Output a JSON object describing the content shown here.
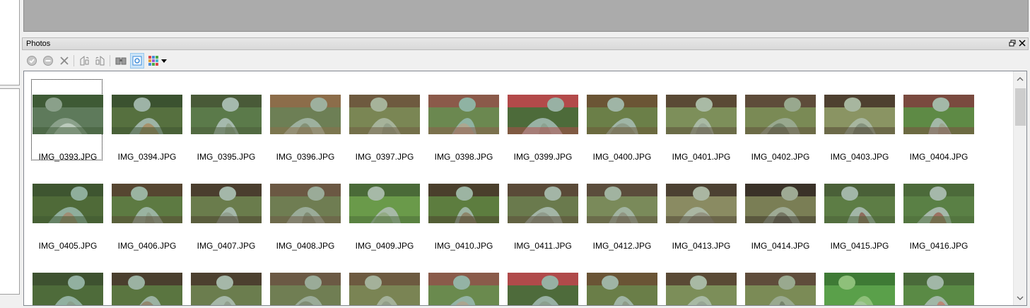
{
  "panel": {
    "title": "Photos"
  },
  "dock_buttons": [
    {
      "name": "restore-icon",
      "glyph": "🗗"
    },
    {
      "name": "close-icon",
      "glyph": "✕"
    }
  ],
  "toolbar": [
    {
      "name": "approve-icon"
    },
    {
      "name": "reject-icon"
    },
    {
      "name": "delete-icon"
    },
    {
      "name": "rotate-left-icon"
    },
    {
      "name": "rotate-right-icon"
    },
    {
      "name": "compare-icon"
    },
    {
      "name": "select-mode-icon"
    },
    {
      "name": "grid-view-icon"
    },
    {
      "name": "dropdown-arrow-icon"
    }
  ],
  "photos": [
    {
      "name": "IMG_0393.JPG",
      "selected": true,
      "colors": [
        "#5e7a5b",
        "#8aa08a",
        "#c7d4c8",
        "#3e5a35"
      ]
    },
    {
      "name": "IMG_0394.JPG",
      "colors": [
        "#56703f",
        "#9db3a6",
        "#a9885d",
        "#3b5230"
      ]
    },
    {
      "name": "IMG_0395.JPG",
      "colors": [
        "#5b7a4a",
        "#a5b9ad",
        "#8c9f84",
        "#495a38"
      ]
    },
    {
      "name": "IMG_0396.JPG",
      "colors": [
        "#6d7f55",
        "#9db09e",
        "#7e8a6c",
        "#8c6d4a"
      ]
    },
    {
      "name": "IMG_0397.JPG",
      "colors": [
        "#7a8654",
        "#a6b39a",
        "#8f9b84",
        "#6e5a3f"
      ]
    },
    {
      "name": "IMG_0398.JPG",
      "colors": [
        "#6b8850",
        "#8fb3a3",
        "#b3a48b",
        "#8b5a4a"
      ]
    },
    {
      "name": "IMG_0399.JPG",
      "colors": [
        "#4d6b3a",
        "#98b1a4",
        "#8a9d8b",
        "#b34a4a"
      ]
    },
    {
      "name": "IMG_0400.JPG",
      "colors": [
        "#6b7f48",
        "#9fb5a6",
        "#8a9783",
        "#6b5535"
      ]
    },
    {
      "name": "IMG_0401.JPG",
      "colors": [
        "#7d8f5a",
        "#a9baa5",
        "#95a292",
        "#5a4a35"
      ]
    },
    {
      "name": "IMG_0402.JPG",
      "colors": [
        "#7a8a55",
        "#98a88e",
        "#6d7a62",
        "#5e4c3a"
      ]
    },
    {
      "name": "IMG_0403.JPG",
      "colors": [
        "#8a9463",
        "#a7b69f",
        "#7c8a74",
        "#4e4030"
      ]
    },
    {
      "name": "IMG_0404.JPG",
      "colors": [
        "#5e8a45",
        "#a3b8a8",
        "#9aa38a",
        "#7a4a3f"
      ]
    },
    {
      "name": "IMG_0405.JPG",
      "colors": [
        "#4f6a38",
        "#8fae9c",
        "#a4866a",
        "#3e5530"
      ]
    },
    {
      "name": "IMG_0406.JPG",
      "colors": [
        "#5d7a42",
        "#9ab3a1",
        "#8b9c86",
        "#564631"
      ]
    },
    {
      "name": "IMG_0407.JPG",
      "colors": [
        "#6a7c4c",
        "#a4b7a9",
        "#8d9a88",
        "#4a3e2e"
      ]
    },
    {
      "name": "IMG_0408.JPG",
      "colors": [
        "#6f7d52",
        "#9aab98",
        "#7a856c",
        "#6b5843"
      ]
    },
    {
      "name": "IMG_0409.JPG",
      "colors": [
        "#6a9a4a",
        "#a6b9a7",
        "#8fa87d",
        "#4a6a38"
      ]
    },
    {
      "name": "IMG_0410.JPG",
      "colors": [
        "#5d7d3f",
        "#9cb4a2",
        "#8a7a5e",
        "#4a3f2c"
      ]
    },
    {
      "name": "IMG_0411.JPG",
      "colors": [
        "#6a7a4d",
        "#a3b5a6",
        "#8b9686",
        "#5a4a38"
      ]
    },
    {
      "name": "IMG_0412.JPG",
      "colors": [
        "#7a8a5a",
        "#a1b3a0",
        "#8d8f7c",
        "#5b4d3c"
      ]
    },
    {
      "name": "IMG_0413.JPG",
      "colors": [
        "#8a8b62",
        "#aab6a2",
        "#8e8c7a",
        "#4c4132"
      ]
    },
    {
      "name": "IMG_0414.JPG",
      "colors": [
        "#7a7e55",
        "#9eaa94",
        "#6a6a58",
        "#3a3228"
      ]
    },
    {
      "name": "IMG_0415.JPG",
      "colors": [
        "#5d7d45",
        "#a2b6a8",
        "#8a5a4a",
        "#4a6038"
      ]
    },
    {
      "name": "IMG_0416.JPG",
      "colors": [
        "#5a8045",
        "#a5b8aa",
        "#9a6050",
        "#4c6a3a"
      ]
    },
    {
      "name": "",
      "colors": [
        "#4e6b3a",
        "#92b0a0",
        "#8a9c88",
        "#3e5230"
      ]
    },
    {
      "name": "",
      "colors": [
        "#5a7540",
        "#9bb2a2",
        "#8e7d62",
        "#4a3f2e"
      ]
    },
    {
      "name": "",
      "colors": [
        "#6b7d4e",
        "#a5b7a8",
        "#8d9a88",
        "#4c402f"
      ]
    },
    {
      "name": "",
      "colors": [
        "#707e53",
        "#9aab98",
        "#7b866d",
        "#6b5944"
      ]
    },
    {
      "name": "",
      "colors": [
        "#7a8454",
        "#a4b19a",
        "#8d9a84",
        "#6d5a40"
      ]
    },
    {
      "name": "",
      "colors": [
        "#6a8a4e",
        "#94b3a5",
        "#b0a38b",
        "#8a5b4a"
      ]
    },
    {
      "name": "",
      "colors": [
        "#4e6b3b",
        "#97b0a3",
        "#8a9c8a",
        "#b04a4a"
      ]
    },
    {
      "name": "",
      "colors": [
        "#6a7e48",
        "#9fb4a5",
        "#899682",
        "#6a5435"
      ]
    },
    {
      "name": "",
      "colors": [
        "#7c8e59",
        "#a8b9a4",
        "#94a191",
        "#5a4a35"
      ]
    },
    {
      "name": "",
      "colors": [
        "#7b8b56",
        "#99a98f",
        "#6e7b63",
        "#5f4d3b"
      ]
    },
    {
      "name": "",
      "colors": [
        "#5aa04a",
        "#8ec07a",
        "#a7c8a0",
        "#3e7a35"
      ]
    },
    {
      "name": "",
      "colors": [
        "#5a8a45",
        "#a1b7a7",
        "#c07a6a",
        "#4a6a3a"
      ]
    }
  ]
}
